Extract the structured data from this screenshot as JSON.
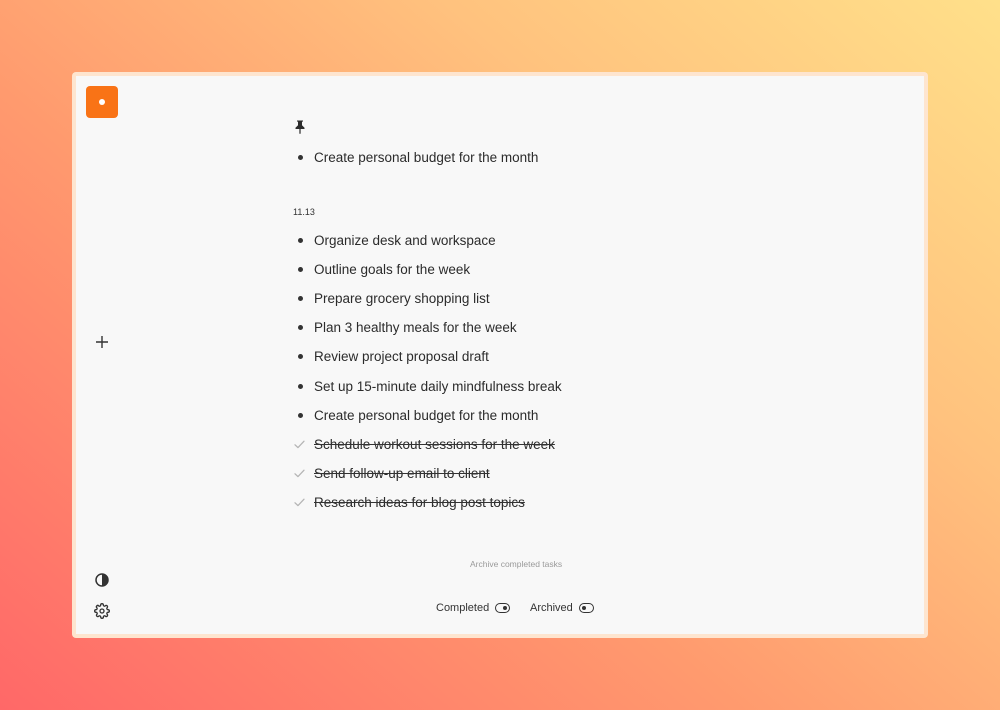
{
  "pinned": {
    "tasks": [
      {
        "text": "Create personal budget for the month",
        "done": false
      }
    ]
  },
  "group": {
    "date": "11.13",
    "tasks": [
      {
        "text": "Organize desk and workspace",
        "done": false
      },
      {
        "text": "Outline goals for the week",
        "done": false
      },
      {
        "text": "Prepare grocery shopping list",
        "done": false
      },
      {
        "text": "Plan 3 healthy meals for the week",
        "done": false
      },
      {
        "text": "Review project proposal draft",
        "done": false
      },
      {
        "text": "Set up 15-minute daily mindfulness break",
        "done": false
      },
      {
        "text": "Create personal budget for the month",
        "done": false
      },
      {
        "text": "Schedule workout sessions for the week",
        "done": true
      },
      {
        "text": "Send follow-up email to client",
        "done": true
      },
      {
        "text": "Research ideas for blog post topics",
        "done": true
      }
    ]
  },
  "footer": {
    "archive_label": "Archive completed tasks",
    "completed_label": "Completed",
    "completed_state": "on",
    "archived_label": "Archived",
    "archived_state": "off"
  },
  "colors": {
    "accent": "#f97316",
    "text": "#2b2b2b",
    "muted": "#9a9a9a",
    "panel": "#f8f8f8"
  },
  "icons": {
    "logo": "logo-icon",
    "add": "plus-icon",
    "theme": "contrast-icon",
    "settings": "gear-icon",
    "pin": "pin-icon",
    "check": "check-icon",
    "bullet": "bullet-icon"
  }
}
